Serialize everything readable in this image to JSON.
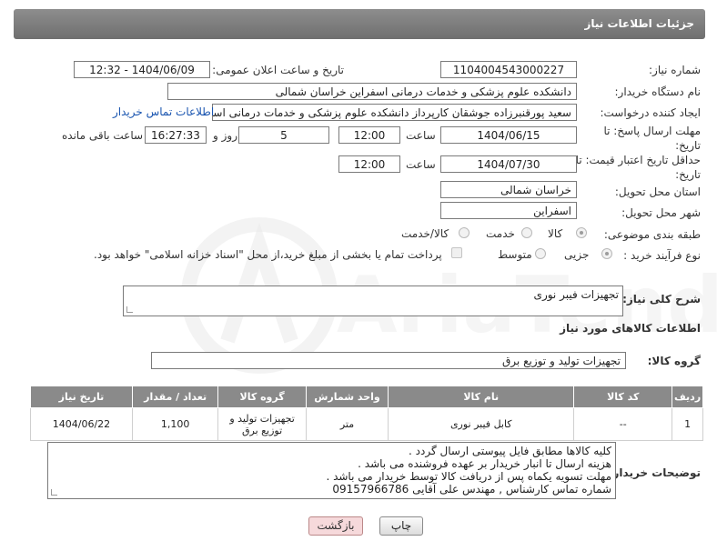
{
  "header": {
    "title": "جزئیات اطلاعات نیاز"
  },
  "form": {
    "need_number_label": "شماره نیاز:",
    "need_number": "1104004543000227",
    "announce_label": "تاریخ و ساعت اعلان عمومی:",
    "announce_value": "1404/06/09 - 12:32",
    "buyer_org_label": "نام دستگاه خریدار:",
    "buyer_org": "دانشکده علوم پزشکی و خدمات درمانی اسفراین خراسان شمالی",
    "requester_label": "ایجاد کننده درخواست:",
    "requester": "سعید پورقنبرزاده جوشقان کارپرداز  دانشکده علوم پزشکی و خدمات درمانی اسفراین",
    "contact_link": "اطلاعات تماس خریدار",
    "reply_deadline_label": "مهلت ارسال پاسخ: تا تاریخ:",
    "reply_date": "1404/06/15",
    "time_label": "ساعت",
    "reply_time": "12:00",
    "days_value": "5",
    "days_label": "روز و",
    "remaining_time": "16:27:33",
    "remaining_label": "ساعت باقی مانده",
    "price_validity_label": "حداقل تاریخ اعتبار قیمت: تا تاریخ:",
    "price_date": "1404/07/30",
    "price_time": "12:00",
    "province_label": "استان محل تحویل:",
    "province": "خراسان شمالی",
    "city_label": "شهر محل تحویل:",
    "city": "اسفراین",
    "category_label": "طبقه بندی موضوعی:",
    "category_options": [
      "کالا",
      "خدمت",
      "کالا/خدمت"
    ],
    "purchase_type_label": "نوع فرآیند خرید :",
    "purchase_options": [
      "جزیی",
      "متوسط"
    ],
    "payment_note": "پرداخت تمام یا بخشی از مبلغ خرید،از محل \"اسناد خزانه اسلامی\" خواهد بود.",
    "description_label": "شرح کلی نیاز:",
    "description": "تجهیزات فیبر نوری"
  },
  "goods": {
    "section_title": "اطلاعات کالاهای مورد نیاز",
    "group_label": "گروه کالا:",
    "group_value": "تجهیزات تولید و توزیع برق",
    "table": {
      "headers": [
        "ردیف",
        "کد کالا",
        "نام کالا",
        "واحد شمارش",
        "گروه کالا",
        "تعداد / مقدار",
        "تاریخ نیاز"
      ],
      "rows": [
        [
          "1",
          "--",
          "کابل فیبر نوری",
          "متر",
          "تجهیزات تولید و توزیع برق",
          "1,100",
          "1404/06/22"
        ]
      ]
    }
  },
  "buyer_notes": {
    "label": "توضیحات خریدار:",
    "lines": [
      "کلیه کالاها مطابق فایل پیوستی ارسال گردد .",
      "هزینه ارسال تا انبار خریدار بر عهده فروشنده می باشد .",
      "مهلت تسویه یکماه پس از دریافت کالا توسط خریدار می باشد .",
      "شماره تماس کارشناس , مهندس علی آقایی 09157966786"
    ]
  },
  "buttons": {
    "print": "چاپ",
    "back": "بازگشت"
  },
  "watermark": {
    "brand": "AriaTender.net"
  }
}
